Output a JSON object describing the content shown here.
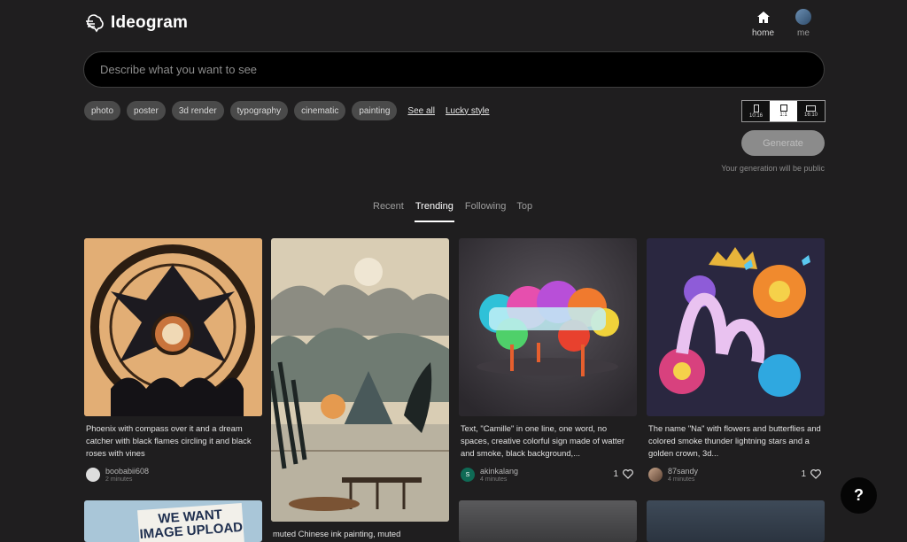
{
  "header": {
    "logo_text": "Ideogram",
    "nav": {
      "home": "home",
      "me": "me"
    }
  },
  "prompt": {
    "placeholder": "Describe what you want to see"
  },
  "chips": [
    "photo",
    "poster",
    "3d render",
    "typography",
    "cinematic",
    "painting"
  ],
  "links": {
    "see_all": "See all",
    "lucky_style": "Lucky style"
  },
  "aspect_ratios": [
    {
      "label": "10:16",
      "selected": false
    },
    {
      "label": "1:1",
      "selected": true
    },
    {
      "label": "16:10",
      "selected": false
    }
  ],
  "generate": {
    "label": "Generate",
    "note": "Your generation will be public"
  },
  "tabs": [
    {
      "label": "Recent",
      "active": false
    },
    {
      "label": "Trending",
      "active": true
    },
    {
      "label": "Following",
      "active": false
    },
    {
      "label": "Top",
      "active": false
    }
  ],
  "cards": [
    {
      "caption": "Phoenix with compass over it and a dream catcher with black flames circling it and black roses with vines",
      "user": "boobabii608",
      "time": "2 minutes",
      "likes": ""
    },
    {
      "caption": "muted Chinese ink painting, muted",
      "user": "",
      "time": "",
      "likes": ""
    },
    {
      "caption": "Text, \"Camille\" in one line, one word, no spaces, creative colorful sign made of watter and smoke, black background,...",
      "user": "akinkalang",
      "avatar_letter": "S",
      "time": "4 minutes",
      "likes": "1"
    },
    {
      "caption": "The name \"Na\" with flowers and butterflies and colored smoke thunder lightning stars and a golden crown, 3d...",
      "user": "87sandy",
      "time": "4 minutes",
      "likes": "1"
    }
  ],
  "lower_cards": [
    {
      "image_text": "WE WANT IMAGE UPLOAD"
    }
  ],
  "help": {
    "label": "?"
  }
}
